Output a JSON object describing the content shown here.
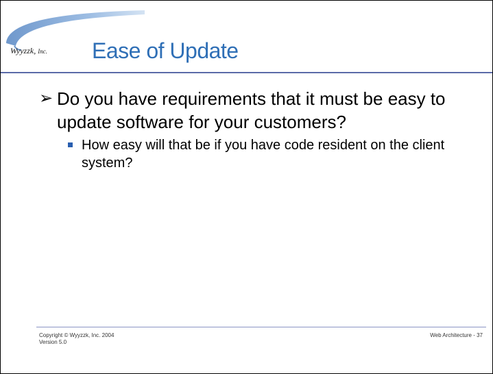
{
  "header": {
    "logo_main": "Wyyzzk,",
    "logo_suffix": "Inc.",
    "title": "Ease of Update"
  },
  "body": {
    "bullets": [
      {
        "icon": "arrow-bullet-icon",
        "text": "Do you have requirements that it must be easy to update software for your customers?",
        "sub": [
          {
            "icon": "square-bullet-icon",
            "text": "How easy will that be if you have code resident on the client system?"
          }
        ]
      }
    ]
  },
  "footer": {
    "copyright": "Copyright © Wyyzzk, Inc. 2004",
    "version": "Version 5.0",
    "page_label": "Web Architecture - 37"
  },
  "colors": {
    "title": "#2f6fb6",
    "swoosh": "#7fa6d6",
    "rule": "#5a6aa8",
    "square_bullet": "#2a5fb0"
  }
}
